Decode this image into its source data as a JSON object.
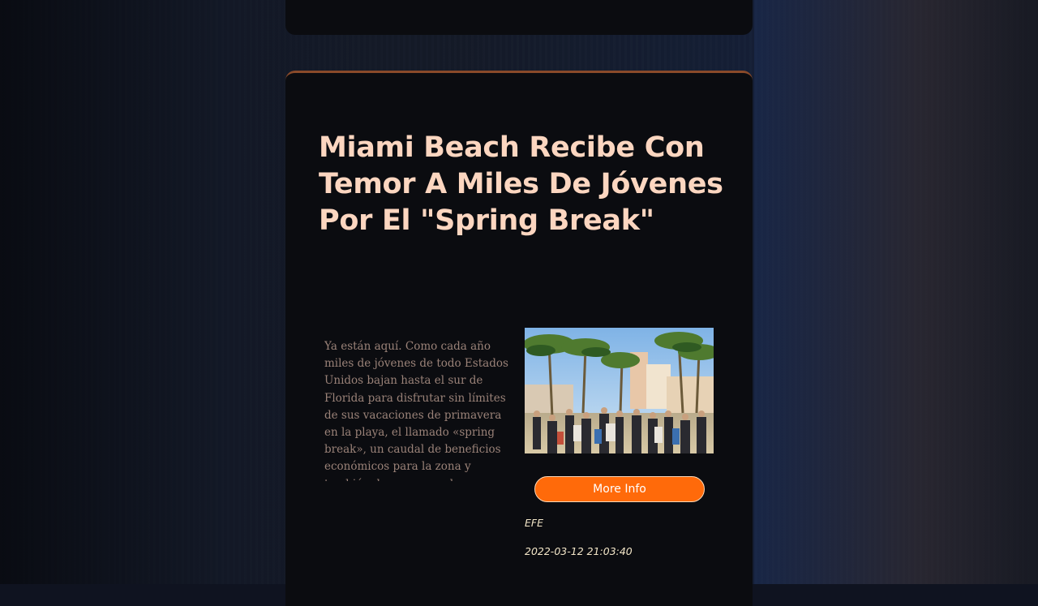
{
  "article": {
    "title": "Miami Beach Recibe Con Temor A Miles De Jóvenes Por El \"Spring Break\"",
    "summary": "Ya están aquí. Como cada año miles de jóvenes de todo Estados Unidos bajan hasta el sur de Florida para disfrutar sin límites de sus vacaciones de primavera en la playa, el llamado «spring break», un caudal de beneficios económicos para la zona y también de excesos y desmanes. Lo de hizo el",
    "more_info_label": "More Info",
    "source": "EFE",
    "published": "2022-03-12 21:03:40"
  },
  "colors": {
    "accent": "#ff6a0a",
    "title": "#fcd6c0",
    "card_background": "#0b0c10"
  }
}
